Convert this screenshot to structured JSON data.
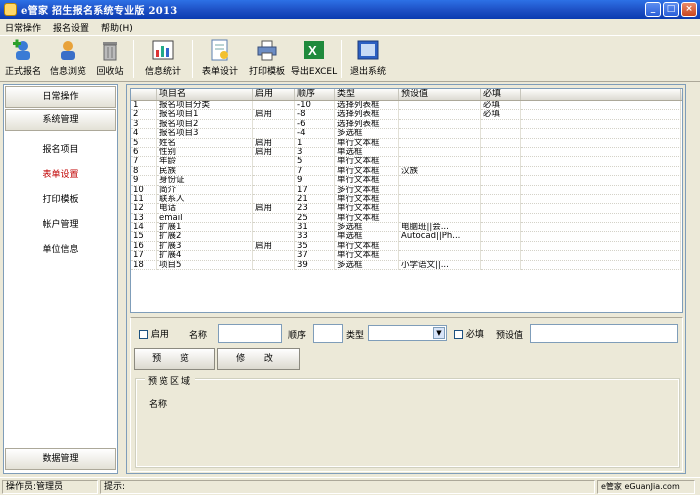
{
  "window": {
    "title": "e管家  招生报名系统专业版 2013",
    "min": "_",
    "max": "□",
    "close": "×"
  },
  "menu": {
    "items": [
      "日常操作",
      "报名设置",
      "帮助(H)"
    ]
  },
  "toolbar": {
    "items": [
      {
        "label": "正式报名",
        "icon": "user-add-icon"
      },
      {
        "label": "信息浏览",
        "icon": "user-icon"
      },
      {
        "label": "回收站",
        "icon": "trash-icon"
      },
      {
        "label": "信息统计",
        "icon": "chart-icon"
      },
      {
        "label": "表单设计",
        "icon": "form-design-icon"
      },
      {
        "label": "打印模板",
        "icon": "printer-icon"
      },
      {
        "label": "导出EXCEL",
        "icon": "excel-icon"
      },
      {
        "label": "退出系统",
        "icon": "exit-icon"
      }
    ]
  },
  "sidebar": {
    "group1": "日常操作",
    "group2": "系统管理",
    "items": [
      "报名项目",
      "表单设置",
      "打印模板",
      "帐户管理",
      "单位信息"
    ],
    "active": "表单设置",
    "footer": "数据管理"
  },
  "table": {
    "headers": [
      "",
      "项目名",
      "启用",
      "顺序",
      "类型",
      "预设值",
      "必填"
    ],
    "rows": [
      [
        "1",
        "报名项目分类",
        "",
        "-10",
        "选择列表框",
        "",
        "必填"
      ],
      [
        "2",
        "报名项目1",
        "启用",
        "-8",
        "选择列表框",
        "",
        "必填"
      ],
      [
        "3",
        "报名项目2",
        "",
        "-6",
        "选择列表框",
        "",
        ""
      ],
      [
        "4",
        "报名项目3",
        "",
        "-4",
        "多选框",
        "",
        ""
      ],
      [
        "5",
        "姓名",
        "启用",
        "1",
        "单行文本框",
        "",
        ""
      ],
      [
        "6",
        "性别",
        "启用",
        "3",
        "单选框",
        "",
        ""
      ],
      [
        "7",
        "年龄",
        "",
        "5",
        "单行文本框",
        "",
        ""
      ],
      [
        "8",
        "民族",
        "",
        "7",
        "单行文本框",
        "汉族",
        ""
      ],
      [
        "9",
        "身份证",
        "",
        "9",
        "单行文本框",
        "",
        ""
      ],
      [
        "10",
        "简介",
        "",
        "17",
        "多行文本框",
        "",
        ""
      ],
      [
        "11",
        "联系人",
        "",
        "21",
        "单行文本框",
        "",
        ""
      ],
      [
        "12",
        "电话",
        "启用",
        "23",
        "单行文本框",
        "",
        ""
      ],
      [
        "13",
        "email",
        "",
        "25",
        "单行文本框",
        "",
        ""
      ],
      [
        "14",
        "扩展1",
        "",
        "31",
        "多选框",
        "电脑班||会...",
        ""
      ],
      [
        "15",
        "扩展2",
        "",
        "33",
        "单选框",
        "Autocad||Ph...",
        ""
      ],
      [
        "16",
        "扩展3",
        "启用",
        "35",
        "单行文本框",
        "",
        ""
      ],
      [
        "17",
        "扩展4",
        "",
        "37",
        "单行文本框",
        "",
        ""
      ],
      [
        "18",
        "项目5",
        "",
        "39",
        "多选框",
        "小学语文||...",
        ""
      ]
    ]
  },
  "form": {
    "enable_label": "启用",
    "name_label": "名称",
    "order_label": "顺序",
    "type_label": "类型",
    "required_label": "必填",
    "default_label": "预设值",
    "preview_btn": "预 览",
    "modify_btn": "修 改",
    "group_title": "预览区域",
    "preview_name": "名称"
  },
  "status": {
    "operator": "操作员:管理员",
    "hint": "提示:",
    "brand": "e管家  eGuanJia.com"
  },
  "colors": {
    "title_blue": "#1d4fc4",
    "active_item": "#c00000"
  }
}
